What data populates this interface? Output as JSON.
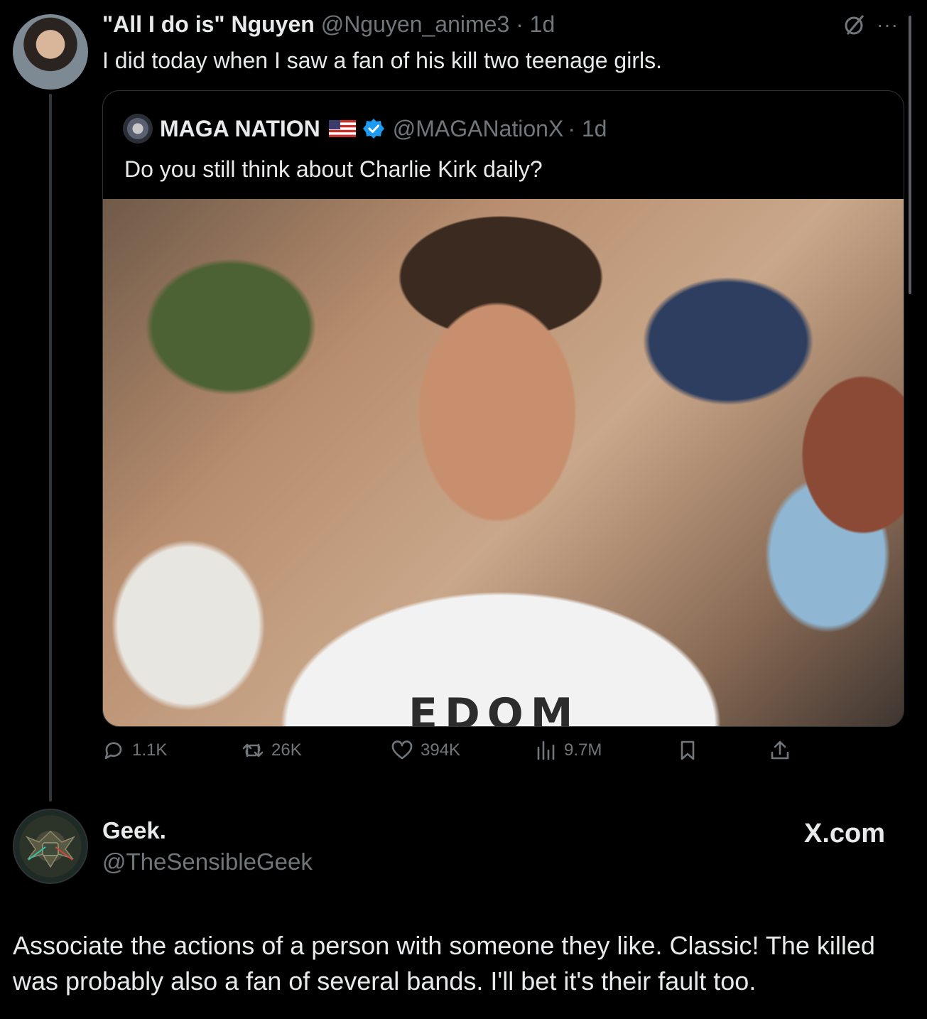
{
  "tweet": {
    "author_name": "\"All I do is\" Nguyen",
    "author_handle": "@Nguyen_anime3",
    "time": "· 1d",
    "text": "I did today when I saw a fan of his kill two teenage girls.",
    "icons": [
      "grok-icon",
      "more-icon"
    ],
    "more_label": "···"
  },
  "quoted_tweet": {
    "author_name": "MAGA NATION",
    "flag": "us-flag-icon",
    "verified": true,
    "author_handle": "@MAGANationX",
    "time": "· 1d",
    "text": "Do you still think about Charlie Kirk daily?",
    "image_text": "FREEDOM",
    "image_visible_text": "EDOM"
  },
  "actions": {
    "replies": "1.1K",
    "reposts": "26K",
    "likes": "394K",
    "views": "9.7M"
  },
  "reply": {
    "author_name": "Geek.",
    "author_handle": "@TheSensibleGeek",
    "watermark": "X.com",
    "text": "Associate the actions of a person with someone they like.  Classic! The killed was probably also a fan of several bands. I'll bet it's their fault too."
  },
  "colors": {
    "background": "#000000",
    "text_primary": "#e7e9ea",
    "text_secondary": "#71767b",
    "border": "#2f3336",
    "verified_blue": "#1d9bf0"
  }
}
